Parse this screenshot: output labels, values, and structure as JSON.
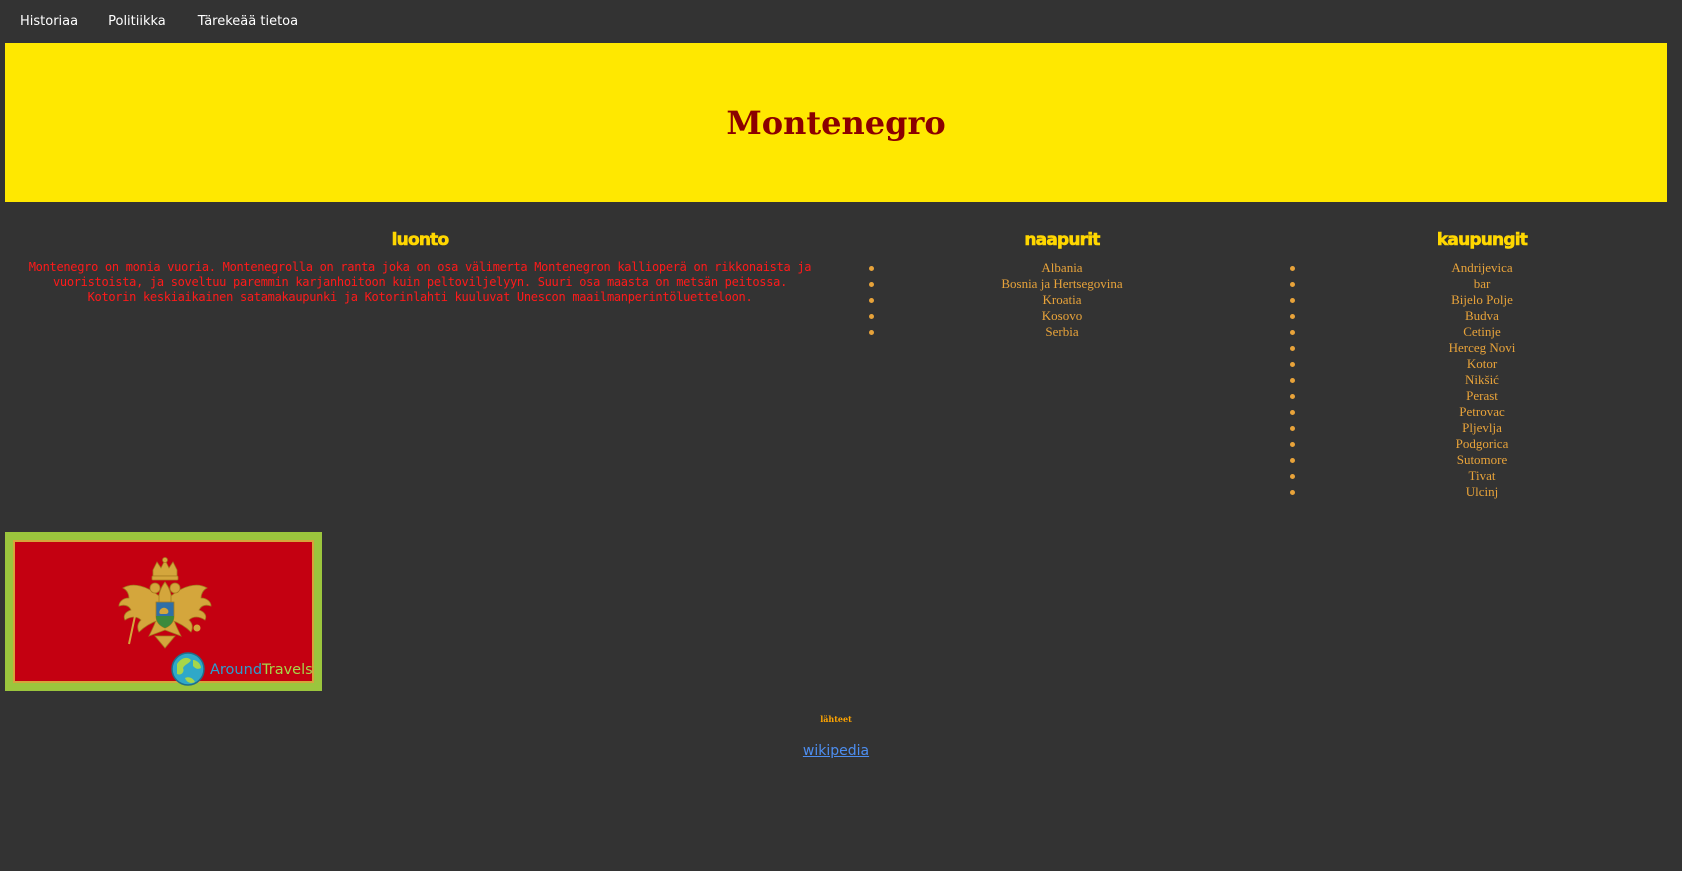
{
  "nav": {
    "items": [
      {
        "label": "Historiaa"
      },
      {
        "label": "Politiikka"
      },
      {
        "label": "Tärekeää tietoa"
      }
    ]
  },
  "banner": {
    "title": "Montenegro",
    "background_color": "#ffe800",
    "title_color": "#8b0000"
  },
  "luonto": {
    "heading": "luonto",
    "text": "Montenegro on monia vuoria. Montenegrolla on ranta joka on osa välimerta Montenegron kallioperä on rikkonaista ja vuoristoista, ja soveltuu paremmin karjanhoitoon kuin peltoviljelyyn. Suuri osa maasta on metsän peitossa. Kotorin keskiaikainen satamakaupunki ja Kotorinlahti kuuluvat Unescon maailmanperintöluetteloon.",
    "text_color": "#ff1a1a"
  },
  "naapurit": {
    "heading": "naapurit",
    "items": [
      "Albania",
      "Bosnia ja Hertsegovina",
      "Kroatia",
      "Kosovo",
      "Serbia"
    ]
  },
  "kaupungit": {
    "heading": "kaupungit",
    "items": [
      "Andrijevica",
      "bar",
      "Bijelo Polje",
      "Budva",
      "Cetinje",
      "Herceg Novi",
      "Kotor",
      "Nikšić",
      "Perast",
      "Petrovac",
      "Pljevlja",
      "Podgorica",
      "Sutomore",
      "Tivat",
      "Ulcinj"
    ]
  },
  "flag": {
    "watermark": "AroundTravels",
    "flag_color": "#c40011",
    "border_color": "#9bc53d"
  },
  "footer": {
    "title": "lähteet",
    "link_label": "wikipedia"
  },
  "colors": {
    "page_background": "#333333",
    "heading_color": "#ffd700",
    "list_color": "#e8a33a",
    "link_color": "#4d8ef0"
  }
}
